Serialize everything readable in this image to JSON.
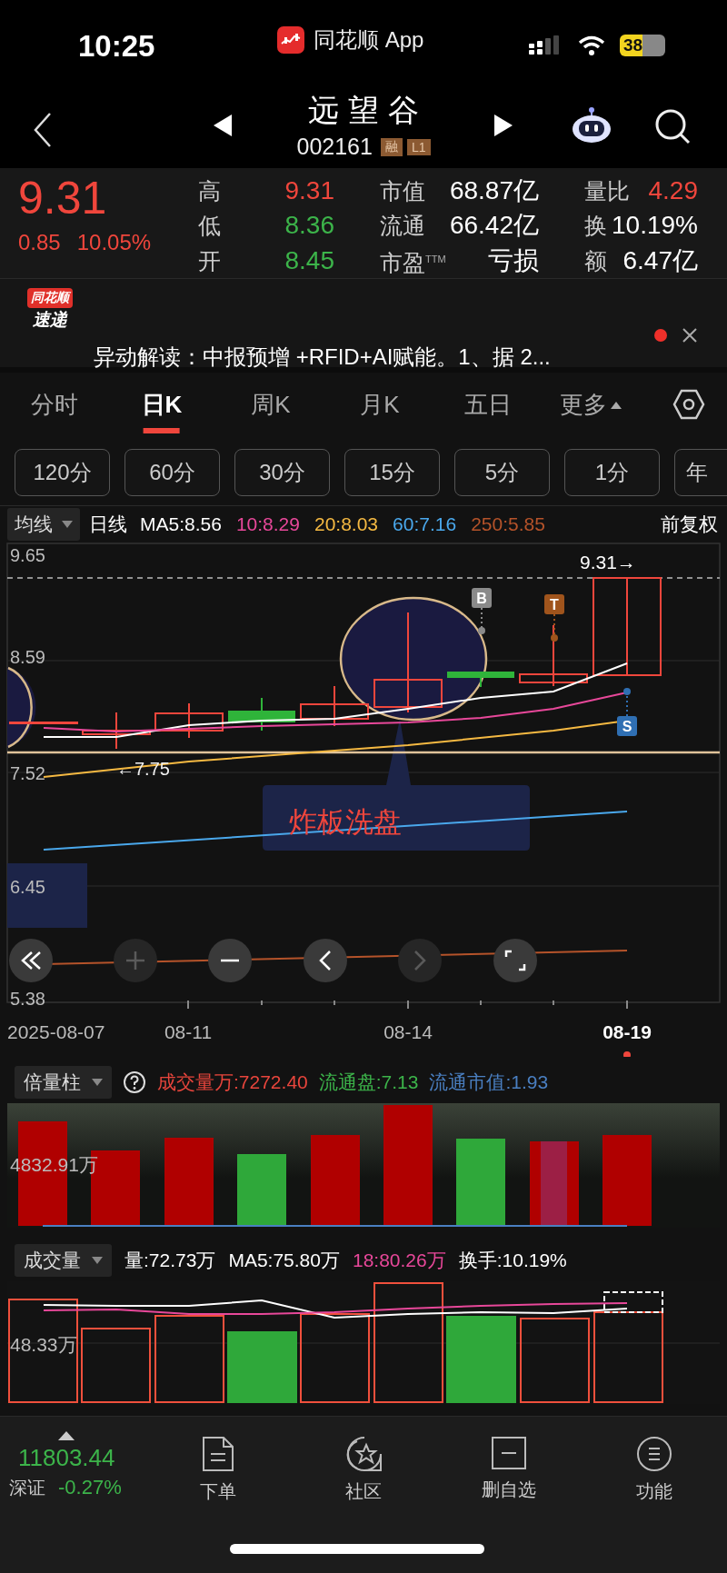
{
  "status_bar": {
    "time": "10:25",
    "app_name": "同花顺 App",
    "battery": "38"
  },
  "header": {
    "stock_name": "远望谷",
    "stock_code": "002161",
    "badges": [
      "融",
      "L1"
    ]
  },
  "quote": {
    "price": "9.31",
    "change": "0.85",
    "change_pct": "10.05%",
    "stats": [
      {
        "label": "高",
        "value": "9.31",
        "color": "#f0463c"
      },
      {
        "label": "市值",
        "value": "68.87亿",
        "color": "#ffffff"
      },
      {
        "label": "量比",
        "value": "4.29",
        "color": "#f0463c"
      },
      {
        "label": "低",
        "value": "8.36",
        "color": "#3cb44a"
      },
      {
        "label": "流通",
        "value": "66.42亿",
        "color": "#ffffff"
      },
      {
        "label": "换",
        "value": "10.19%",
        "color": "#ffffff"
      },
      {
        "label": "开",
        "value": "8.45",
        "color": "#3cb44a"
      },
      {
        "label": "市盈$^{TTM}$",
        "value": "亏损",
        "color": "#ffffff"
      },
      {
        "label": "额",
        "value": "6.47亿",
        "color": "#ffffff"
      }
    ]
  },
  "news": {
    "logo_top": "同花顺",
    "logo_bottom": "速递",
    "text": "异动解读：中报预增 +RFID+AI赋能。1、据 2...",
    "unread": true
  },
  "period_tabs": [
    {
      "label": "分时",
      "selected": false,
      "kind": "tab"
    },
    {
      "label": "日K",
      "selected": true,
      "kind": "tab"
    },
    {
      "label": "周K",
      "selected": false,
      "kind": "tab"
    },
    {
      "label": "月K",
      "selected": false,
      "kind": "tab"
    },
    {
      "label": "五日",
      "selected": false,
      "kind": "tab"
    },
    {
      "label": "更多",
      "selected": false,
      "kind": "menu"
    }
  ],
  "intervals": [
    "120分",
    "60分",
    "30分",
    "15分",
    "5分",
    "1分",
    "年"
  ],
  "ma_legend": {
    "selector": "均线",
    "period": "日线",
    "values": [
      {
        "label": "MA5:8.56",
        "color": "#ffffff"
      },
      {
        "label": "10:8.29",
        "color": "#e8489a"
      },
      {
        "label": "20:8.03",
        "color": "#f5b942"
      },
      {
        "label": "60:7.16",
        "color": "#4aa8ec"
      },
      {
        "label": "250:5.85",
        "color": "#b5532a"
      }
    ],
    "adjust": "前复权"
  },
  "price_chart": {
    "y_labels": [
      "9.65",
      "8.59",
      "7.52",
      "6.45",
      "5.38"
    ],
    "last_price_label": "9.31→",
    "low_label": "←7.75",
    "signals": [
      {
        "label": "B",
        "color": "#8a8a8a"
      },
      {
        "label": "T",
        "color": "#a0541c"
      },
      {
        "label": "S",
        "color": "#2f6fb3"
      }
    ],
    "annotation": "炸板洗盘",
    "controls": [
      {
        "kind": "fast-back",
        "disabled": false
      },
      {
        "kind": "zoom-in",
        "disabled": true
      },
      {
        "kind": "zoom-out",
        "disabled": false
      },
      {
        "kind": "back",
        "disabled": false
      },
      {
        "kind": "forward",
        "disabled": true
      },
      {
        "kind": "fullscreen",
        "disabled": false
      }
    ],
    "x_labels": [
      {
        "label": "2025-08-07",
        "selected": false
      },
      {
        "label": "08-11",
        "selected": false
      },
      {
        "label": "08-14",
        "selected": false
      },
      {
        "label": "08-19",
        "selected": true
      }
    ]
  },
  "multiple_volume": {
    "selector": "倍量柱",
    "values": [
      {
        "label": "成交量万:7272.40",
        "color": "#e8453c"
      },
      {
        "label": "流通盘:7.13",
        "color": "#3cb44a"
      },
      {
        "label": "流通市值:1.93",
        "color": "#4a7fc1"
      }
    ],
    "y_label": "4832.91万"
  },
  "volume": {
    "selector": "成交量",
    "values": [
      {
        "label": "量:72.73万",
        "color": "#ffffff"
      },
      {
        "label": "MA5:75.80万",
        "color": "#ffffff"
      },
      {
        "label": "18:80.26万",
        "color": "#e8489a"
      },
      {
        "label": "换手:10.19%",
        "color": "#ffffff"
      }
    ],
    "y_label": "48.33万"
  },
  "index_ticker": {
    "value": "11803.44",
    "name": "深证",
    "change": "-0.27%"
  },
  "bottom_nav": [
    {
      "label": "下单",
      "kind": "order"
    },
    {
      "label": "社区",
      "kind": "community"
    },
    {
      "label": "删自选",
      "kind": "remove"
    },
    {
      "label": "功能",
      "kind": "functions"
    }
  ]
}
